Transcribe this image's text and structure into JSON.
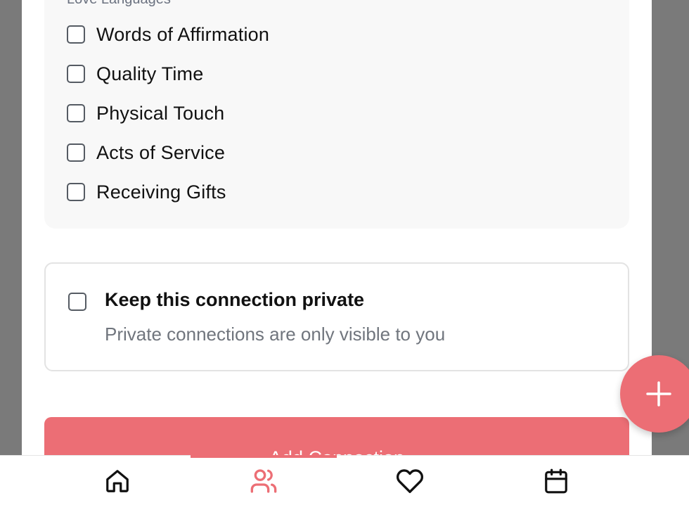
{
  "love_languages": {
    "section_label": "Love Languages",
    "options": [
      {
        "label": "Words of Affirmation",
        "checked": false
      },
      {
        "label": "Quality Time",
        "checked": false
      },
      {
        "label": "Physical Touch",
        "checked": false
      },
      {
        "label": "Acts of Service",
        "checked": false
      },
      {
        "label": "Receiving Gifts",
        "checked": false
      }
    ]
  },
  "privacy": {
    "title": "Keep this connection private",
    "description": "Private connections are only visible to you",
    "checked": false
  },
  "submit": {
    "label": "Add Connection"
  },
  "fab": {
    "icon": "plus-icon"
  },
  "bottom_nav": {
    "active": "connections",
    "items": [
      {
        "id": "home",
        "icon": "home-icon"
      },
      {
        "id": "connections",
        "icon": "users-icon"
      },
      {
        "id": "favorites",
        "icon": "heart-icon"
      },
      {
        "id": "calendar",
        "icon": "calendar-icon"
      }
    ]
  },
  "colors": {
    "accent": "#ec6e75",
    "backdrop": "#7a7a7a",
    "card_bg": "#f8f8f8",
    "muted_text": "#70757d"
  }
}
